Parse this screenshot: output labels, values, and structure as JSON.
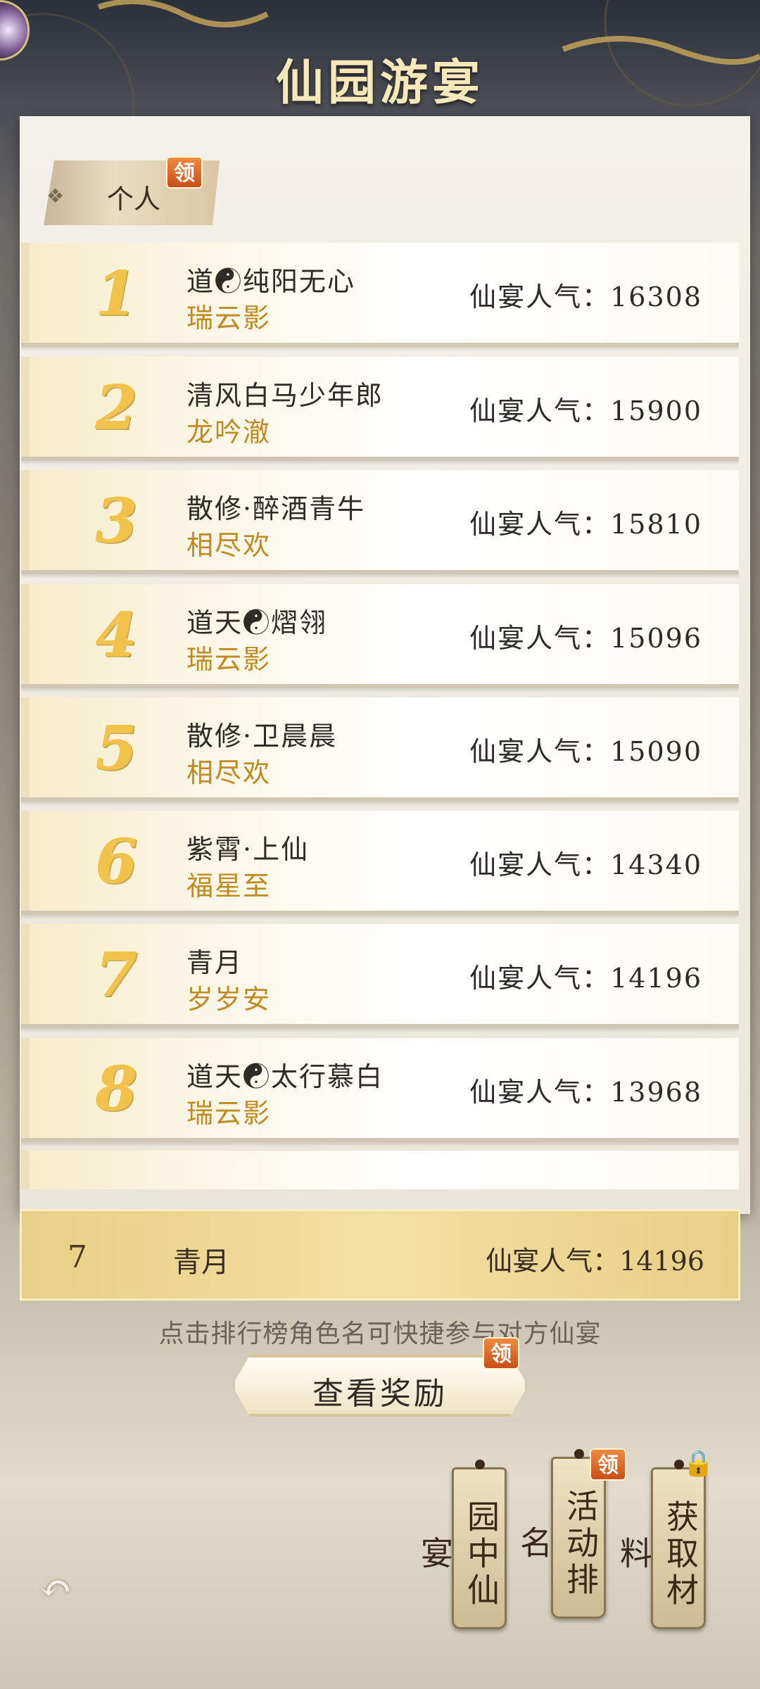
{
  "title": "仙园游宴",
  "tab": {
    "label": "个人",
    "badge": "领"
  },
  "rows": [
    {
      "rank": "1",
      "name": "道☯纯阳无心",
      "guild": "瑞云影",
      "score": "仙宴人气：16308"
    },
    {
      "rank": "2",
      "name": "清风白马少年郎",
      "guild": "龙吟澈",
      "score": "仙宴人气：15900"
    },
    {
      "rank": "3",
      "name": "散修·醉酒青牛",
      "guild": "相尽欢",
      "score": "仙宴人气：15810"
    },
    {
      "rank": "4",
      "name": "道天☯熠翎",
      "guild": "瑞云影",
      "score": "仙宴人气：15096"
    },
    {
      "rank": "5",
      "name": "散修·卫晨晨",
      "guild": "相尽欢",
      "score": "仙宴人气：15090"
    },
    {
      "rank": "6",
      "name": "紫霄·上仙",
      "guild": "福星至",
      "score": "仙宴人气：14340"
    },
    {
      "rank": "7",
      "name": "青月",
      "guild": "岁岁安",
      "score": "仙宴人气：14196"
    },
    {
      "rank": "8",
      "name": "道天☯太行慕白",
      "guild": "瑞云影",
      "score": "仙宴人气：13968"
    }
  ],
  "mine": {
    "rank": "7",
    "name": "青月",
    "score": "仙宴人气：14196"
  },
  "tip": "点击排行榜角色名可快捷参与对方仙宴",
  "reward": {
    "label": "查看奖励",
    "badge": "领"
  },
  "side_tags": [
    {
      "label": "园中仙宴"
    },
    {
      "label": "活动排名",
      "badge": "领"
    },
    {
      "label": "获取材料",
      "icon": "lock-icon"
    }
  ],
  "icons": {
    "back": "back-arrow-icon",
    "avatar": "avatar-icon",
    "tab": "diamond-icon"
  },
  "colors": {
    "accent": "#c08a1e",
    "badge": "#e06a2a",
    "rank": "#f3c24a"
  }
}
